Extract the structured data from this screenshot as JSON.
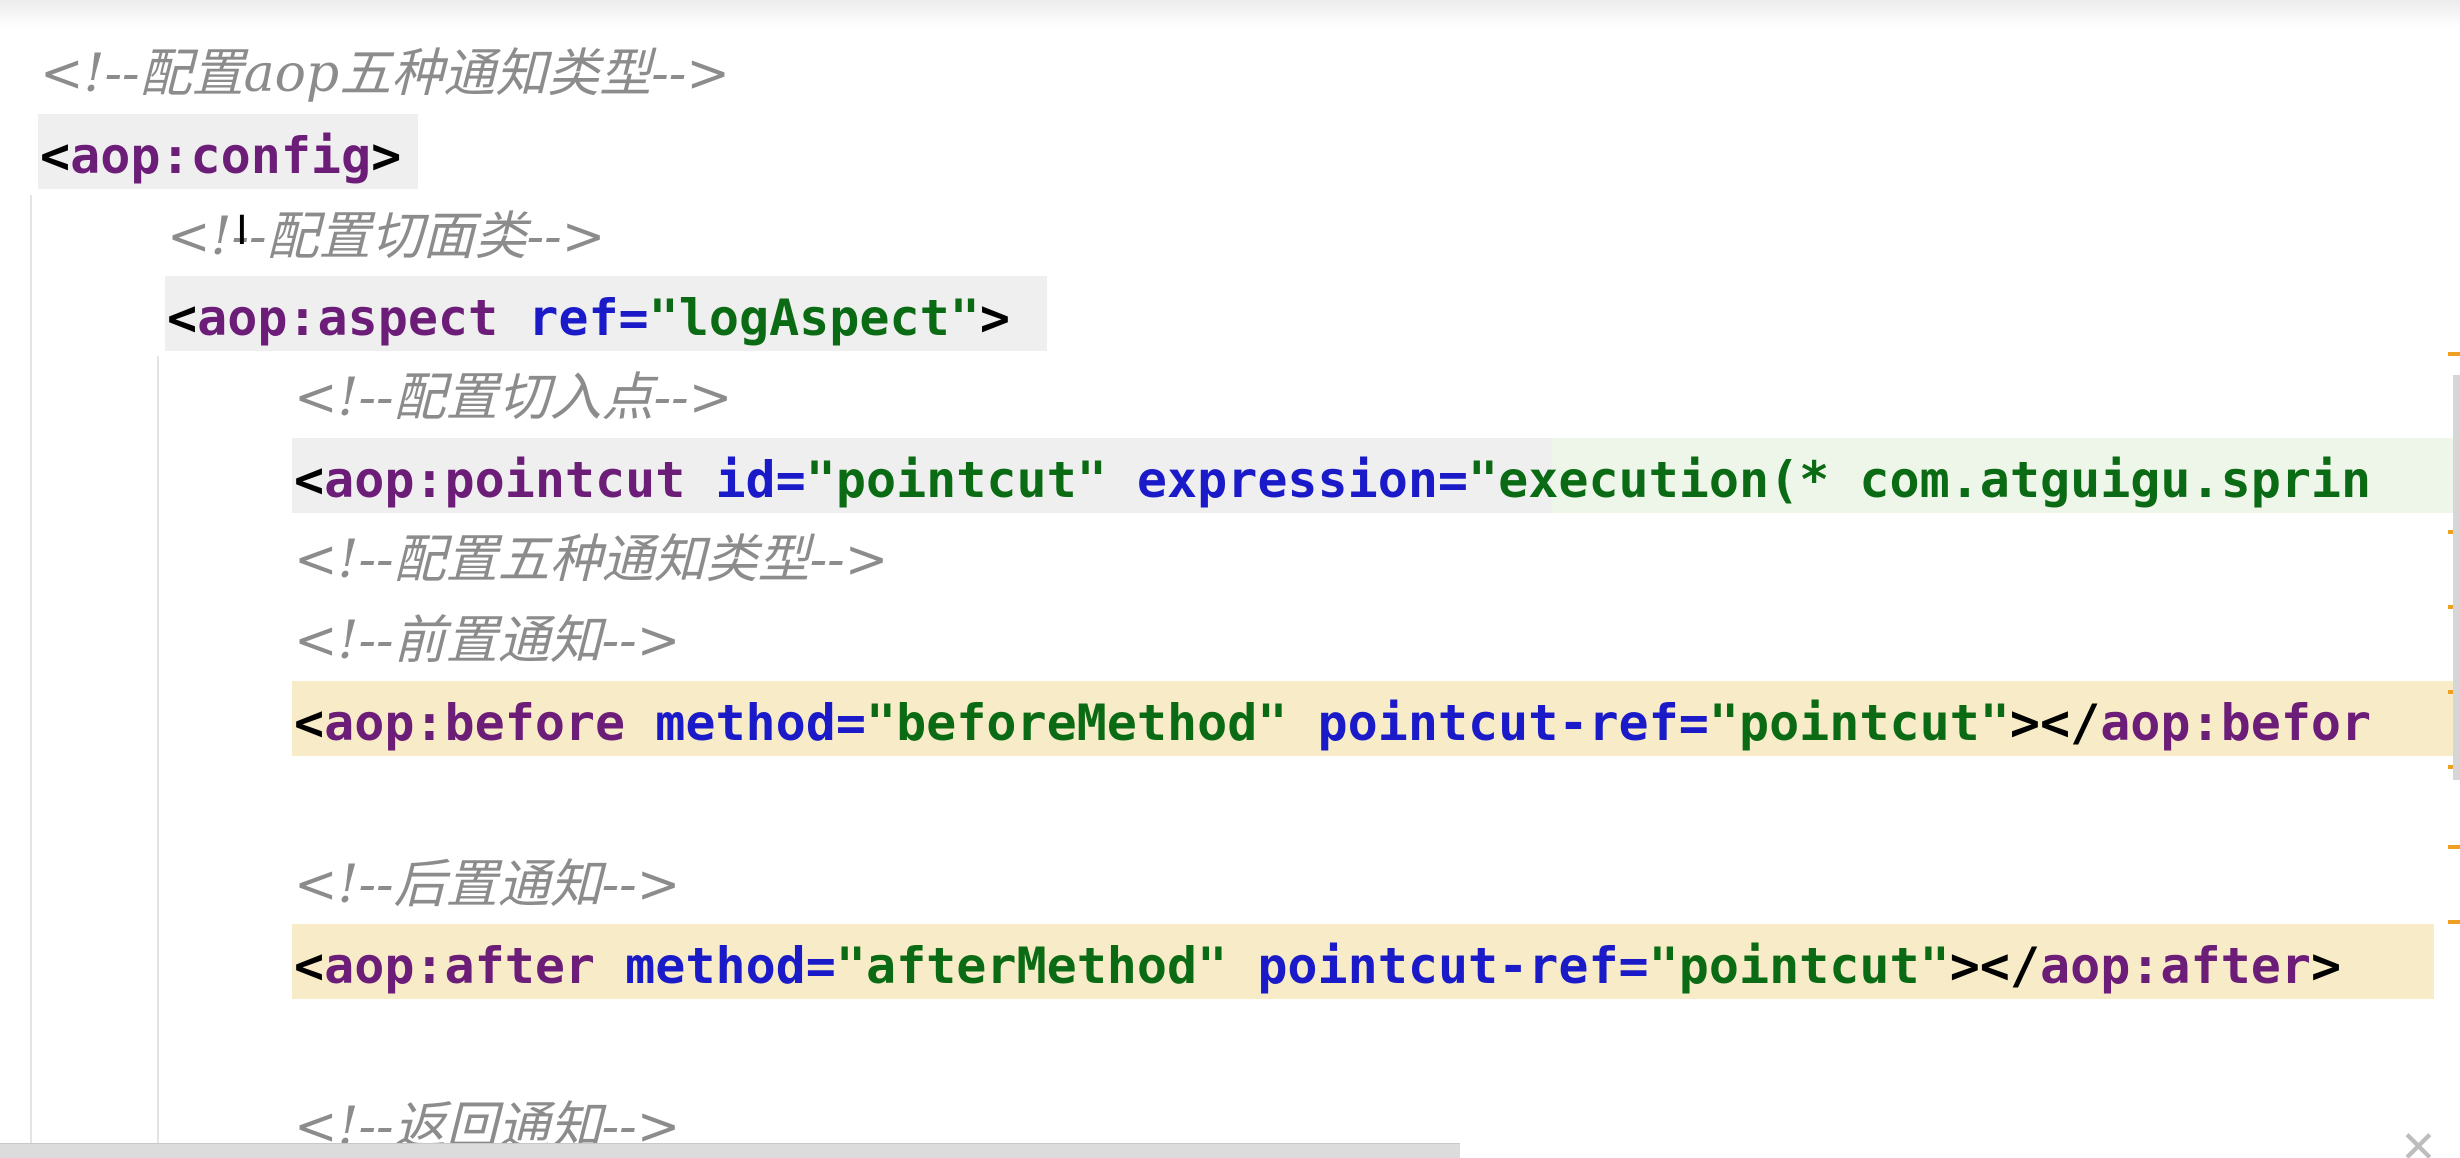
{
  "editor": {
    "lines": [
      {
        "comment": "<!--配置aop五种通知类型-->"
      },
      {
        "tag_open": "<",
        "tag": "aop:config",
        "tag_close": ">"
      },
      {
        "comment": "<!--配置切面类-->"
      },
      {
        "tag_open": "<",
        "tag": "aop:aspect",
        "attr1": "ref=",
        "val1": "\"logAspect\"",
        "tag_close": ">"
      },
      {
        "comment": "<!--配置切入点-->"
      },
      {
        "tag_open": "<",
        "tag": "aop:pointcut",
        "attr1": "id=",
        "val1": "\"pointcut\"",
        "attr2": "expression=",
        "val2": "\"execution(* com.atguigu.sprin"
      },
      {
        "comment": "<!--配置五种通知类型-->"
      },
      {
        "comment": "<!--前置通知-->"
      },
      {
        "tag_open": "<",
        "tag": "aop:before",
        "attr1": "method=",
        "val1": "\"beforeMethod\"",
        "attr2": "pointcut-ref=",
        "val2": "\"pointcut\"",
        "mid": "></",
        "end_tag": "aop:befor"
      },
      {
        "comment": "<!--后置通知-->"
      },
      {
        "tag_open": "<",
        "tag": "aop:after",
        "attr1": "method=",
        "val1": "\"afterMethod\"",
        "attr2": "pointcut-ref=",
        "val2": "\"pointcut\"",
        "mid": "></",
        "end_tag": "aop:after",
        "tag_close": ">"
      },
      {
        "comment": "<!--返回通知-->"
      }
    ]
  },
  "cursor": {
    "icon": "text-cursor-icon",
    "glyph": "I"
  },
  "corner": {
    "icon": "close-icon",
    "glyph": "✕"
  },
  "colors": {
    "tag": "#6b1d78",
    "attribute": "#1a1ac8",
    "value": "#0b6b14",
    "comment": "#8c8c8c",
    "highlight_yellow": "#f8ecc8",
    "highlight_gray": "#efefef"
  }
}
